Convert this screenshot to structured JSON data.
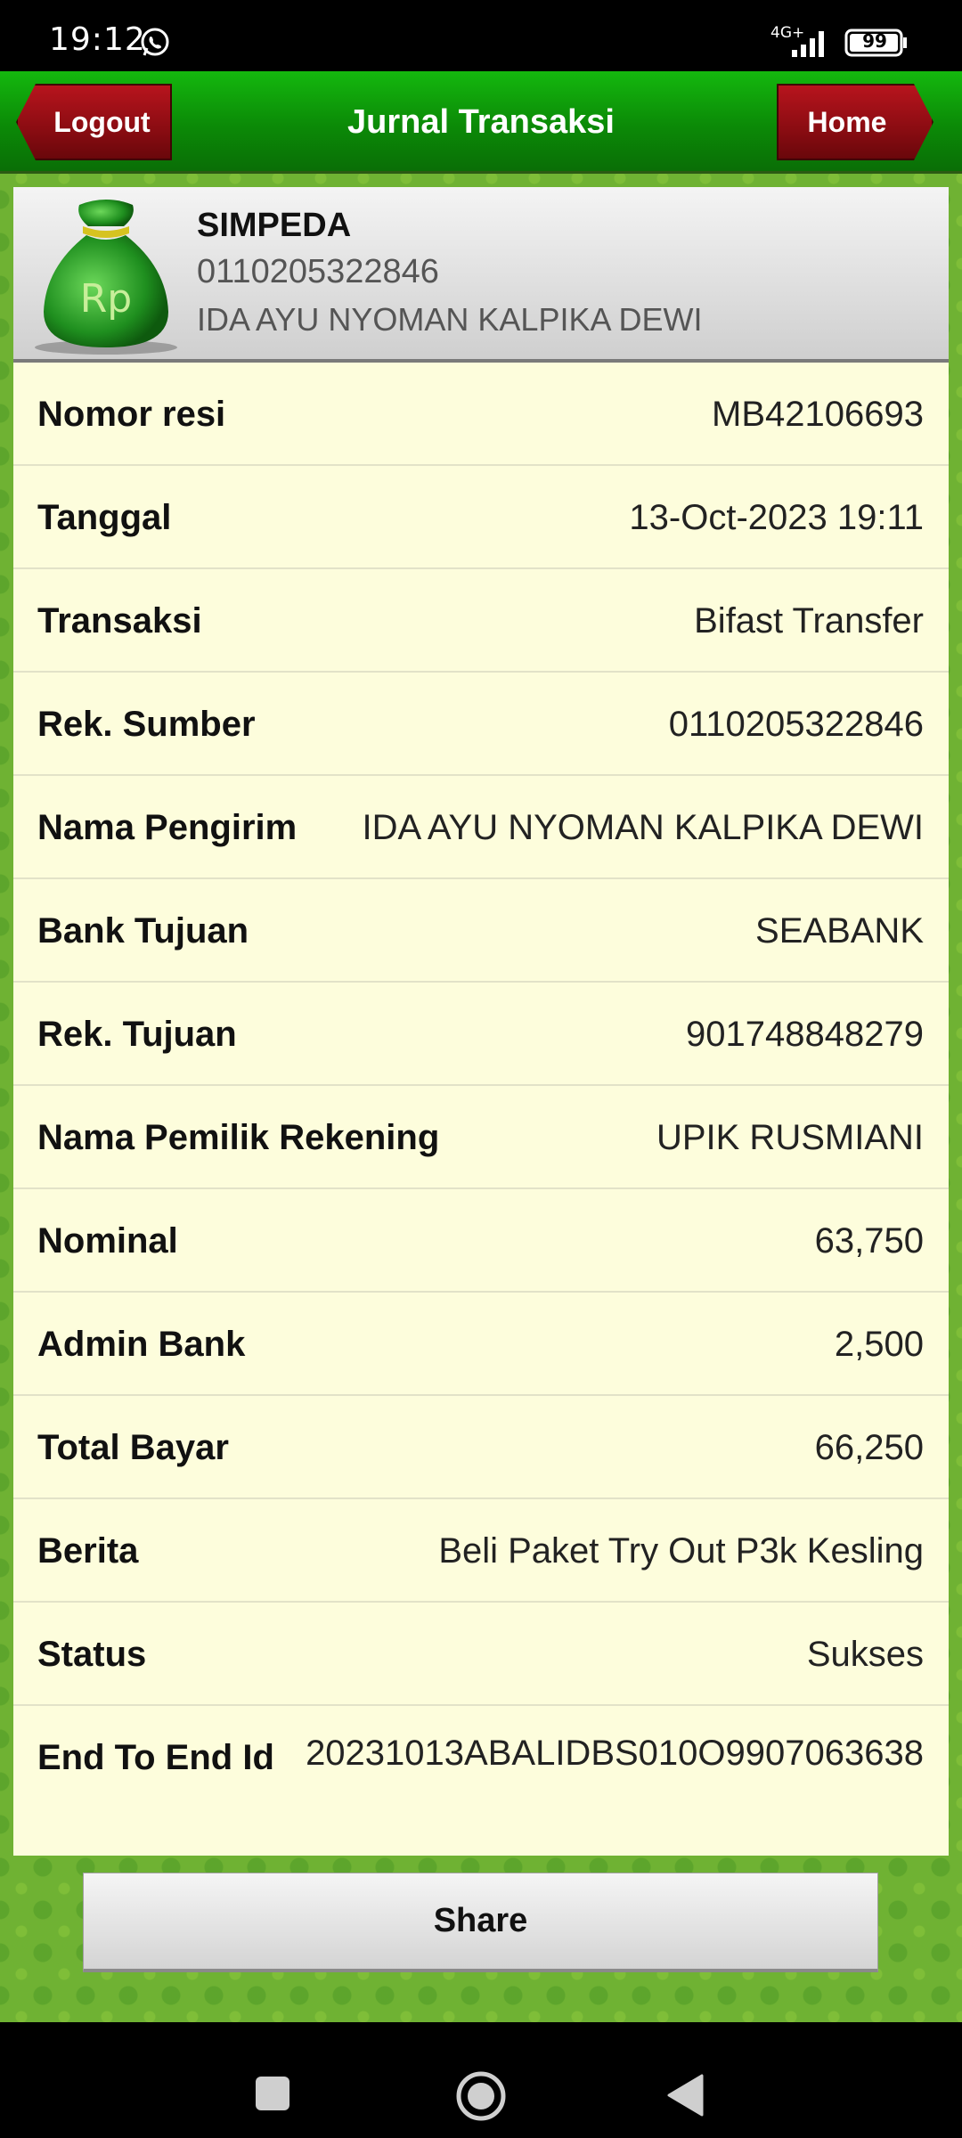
{
  "status_bar": {
    "time": "19:12",
    "network": "4G+",
    "battery": "99",
    "icons": [
      "whatsapp-icon",
      "signal-icon",
      "battery-icon"
    ]
  },
  "header": {
    "title": "Jurnal Transaksi",
    "logout_label": "Logout",
    "home_label": "Home"
  },
  "account": {
    "type": "SIMPEDA",
    "number": "0110205322846",
    "name": "IDA AYU NYOMAN KALPIKA DEWI",
    "icon": "money-bag-icon",
    "icon_text": "Rp"
  },
  "details": [
    {
      "label": "Nomor resi",
      "value": "MB42106693"
    },
    {
      "label": "Tanggal",
      "value": "13-Oct-2023 19:11"
    },
    {
      "label": "Transaksi",
      "value": "Bifast Transfer"
    },
    {
      "label": "Rek. Sumber",
      "value": "0110205322846"
    },
    {
      "label": "Nama Pengirim",
      "value": "IDA AYU NYOMAN KALPIKA DEWI"
    },
    {
      "label": "Bank Tujuan",
      "value": "SEABANK"
    },
    {
      "label": "Rek. Tujuan",
      "value": "901748848279"
    },
    {
      "label": "Nama Pemilik Rekening",
      "value": "UPIK RUSMIANI"
    },
    {
      "label": "Nominal",
      "value": "63,750"
    },
    {
      "label": "Admin Bank",
      "value": "2,500"
    },
    {
      "label": "Total Bayar",
      "value": "66,250"
    },
    {
      "label": "Berita",
      "value": "Beli Paket Try Out P3k Kesling"
    },
    {
      "label": "Status",
      "value": "Sukses"
    },
    {
      "label": "End To End Id",
      "value": "20231013ABALIDBS010O9907063638"
    }
  ],
  "share_label": "Share",
  "colors": {
    "header_green": "#0b8a07",
    "button_red": "#8a0c12",
    "detail_bg": "#fdfddc"
  }
}
